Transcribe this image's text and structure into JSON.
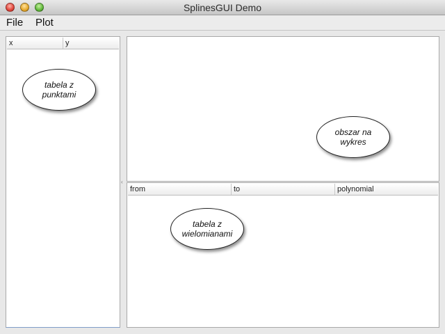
{
  "window": {
    "title": "SplinesGUI Demo"
  },
  "menu": {
    "items": [
      {
        "label": "File"
      },
      {
        "label": "Plot"
      }
    ]
  },
  "points_table": {
    "columns": [
      "x",
      "y"
    ],
    "annotation": "tabela z\npunktami"
  },
  "plot_area": {
    "annotation": "obszar na\nwykres"
  },
  "polynomial_table": {
    "columns": [
      "from",
      "to",
      "polynomial"
    ],
    "annotation": "tabela z\nwielomianami"
  },
  "icons": {
    "close": "close-button-icon",
    "minimize": "minimize-button-icon",
    "maximize": "maximize-button-icon",
    "splitter": "splitter-grip-icon"
  },
  "colors": {
    "window_background": "#e8e8e8",
    "close": "#e0443a",
    "minimize": "#e6a82a",
    "maximize": "#60b83a"
  }
}
